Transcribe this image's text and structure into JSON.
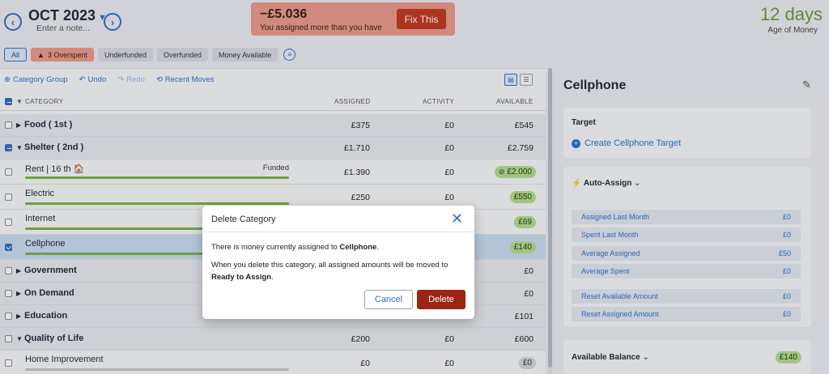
{
  "header": {
    "month": "OCT 2023",
    "note_placeholder": "Enter a note...",
    "alert_amount": "−£5.036",
    "alert_message": "You assigned more than you have",
    "fix_label": "Fix This",
    "age_value": "12 days",
    "age_label": "Age of Money"
  },
  "filters": {
    "all": "All",
    "overspent": "3 Overspent",
    "underfunded": "Underfunded",
    "overfunded": "Overfunded",
    "money_available": "Money Available"
  },
  "toolbar": {
    "category_group": "Category Group",
    "undo": "Undo",
    "redo": "Redo",
    "recent_moves": "Recent Moves"
  },
  "columns": {
    "category": "CATEGORY",
    "assigned": "ASSIGNED",
    "activity": "ACTIVITY",
    "available": "AVAILABLE"
  },
  "rows": {
    "food": {
      "name": "Food ( 1st )",
      "assigned": "£375",
      "activity": "£0",
      "available": "£545"
    },
    "shelter": {
      "name": "Shelter ( 2nd )",
      "assigned": "£1.710",
      "activity": "£0",
      "available": "£2.759"
    },
    "rent": {
      "name": "Rent | 16 th 🏠",
      "status": "Funded",
      "assigned": "£1.390",
      "activity": "£0",
      "available": "£2.000",
      "progress": 1.0
    },
    "electric": {
      "name": "Electric",
      "assigned": "£250",
      "activity": "£0",
      "available": "£550",
      "progress": 1.0
    },
    "internet": {
      "name": "Internet",
      "available": "£69",
      "progress": 1.0
    },
    "cellphone": {
      "name": "Cellphone",
      "available": "£140",
      "progress": 1.0
    },
    "government": {
      "name": "Government",
      "available": "£0"
    },
    "on_demand": {
      "name": "On Demand",
      "available": "£0"
    },
    "education": {
      "name": "Education",
      "available": "£101"
    },
    "quality": {
      "name": "Quality of Life",
      "assigned": "£200",
      "activity": "£0",
      "available": "£600"
    },
    "home": {
      "name": "Home Improvement",
      "assigned": "£0",
      "activity": "£0",
      "available": "£0",
      "progress": 0.0
    }
  },
  "modal": {
    "title": "Delete Category",
    "line1_prefix": "There is money currently assigned to ",
    "line1_bold": "Cellphone",
    "line1_suffix": ".",
    "line2_prefix": "When you delete this category, all assigned amounts will be moved to ",
    "line2_bold": "Ready to Assign",
    "line2_suffix": ".",
    "cancel": "Cancel",
    "delete": "Delete"
  },
  "inspector": {
    "title": "Cellphone",
    "target_heading": "Target",
    "create_target": "Create Cellphone Target",
    "auto_assign": "Auto-Assign",
    "stats": [
      {
        "label": "Assigned Last Month",
        "value": "£0"
      },
      {
        "label": "Spent Last Month",
        "value": "£0"
      },
      {
        "label": "Average Assigned",
        "value": "£50"
      },
      {
        "label": "Average Spent",
        "value": "£0"
      },
      {
        "label": "Reset Available Amount",
        "value": "£0"
      },
      {
        "label": "Reset Assigned Amount",
        "value": "£0"
      }
    ],
    "available_balance": "Available Balance",
    "available_balance_value": "£140"
  },
  "colors": {
    "accent": "#2f6fd1",
    "overspent": "#ec9a8b",
    "danger": "#9b2412",
    "funded_green": "#7db244"
  }
}
